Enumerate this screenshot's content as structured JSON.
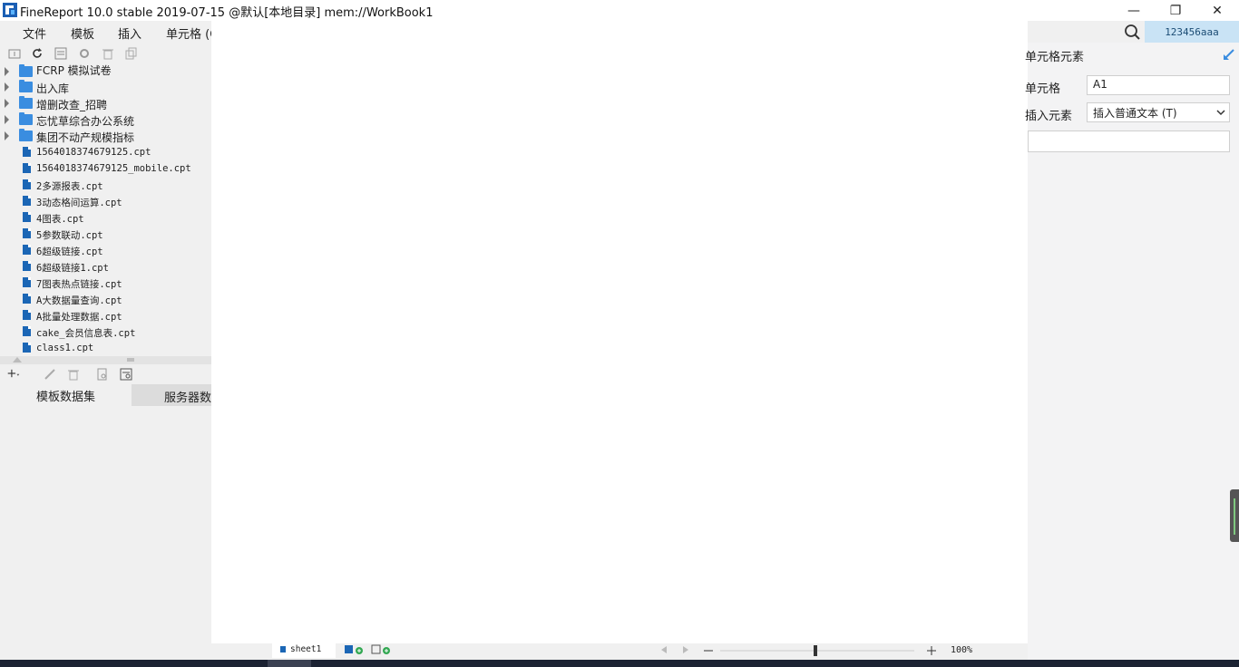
{
  "window": {
    "title": "FineReport 10.0 stable 2019-07-15 @默认[本地目录]    mem://WorkBook1",
    "controls": {
      "minimize": "—",
      "restore": "❐",
      "close": "✕"
    }
  },
  "menubar": {
    "items": [
      "文件",
      "模板",
      "插入",
      "单元格 (C"
    ]
  },
  "header": {
    "user": "123456aaa"
  },
  "tree": {
    "folders": [
      "FCRP 模拟试卷",
      "出入库",
      "增删改查_招聘",
      "忘忧草综合办公系统",
      "集团不动产规模指标"
    ],
    "files": [
      "1564018374679125.cpt",
      "1564018374679125_mobile.cpt",
      "2多源报表.cpt",
      "3动态格间运算.cpt",
      "4图表.cpt",
      "5参数联动.cpt",
      "6超级链接.cpt",
      "6超级链接1.cpt",
      "7图表热点链接.cpt",
      "A大数据量查询.cpt",
      "A批量处理数据.cpt",
      "cake_会员信息表.cpt",
      "class1.cpt"
    ]
  },
  "dataset_tabs": {
    "template": "模板数据集",
    "server": "服务器数据集"
  },
  "sheets": {
    "active": "sheet1"
  },
  "zoom": {
    "value": "100%"
  },
  "properties": {
    "title": "单元格元素",
    "cell_label": "单元格",
    "cell_value": "A1",
    "insert_label": "插入元素",
    "insert_value": "插入普通文本 (T)"
  },
  "colors": {
    "accent": "#3a8de0",
    "user_bg": "#c9e3f5"
  }
}
